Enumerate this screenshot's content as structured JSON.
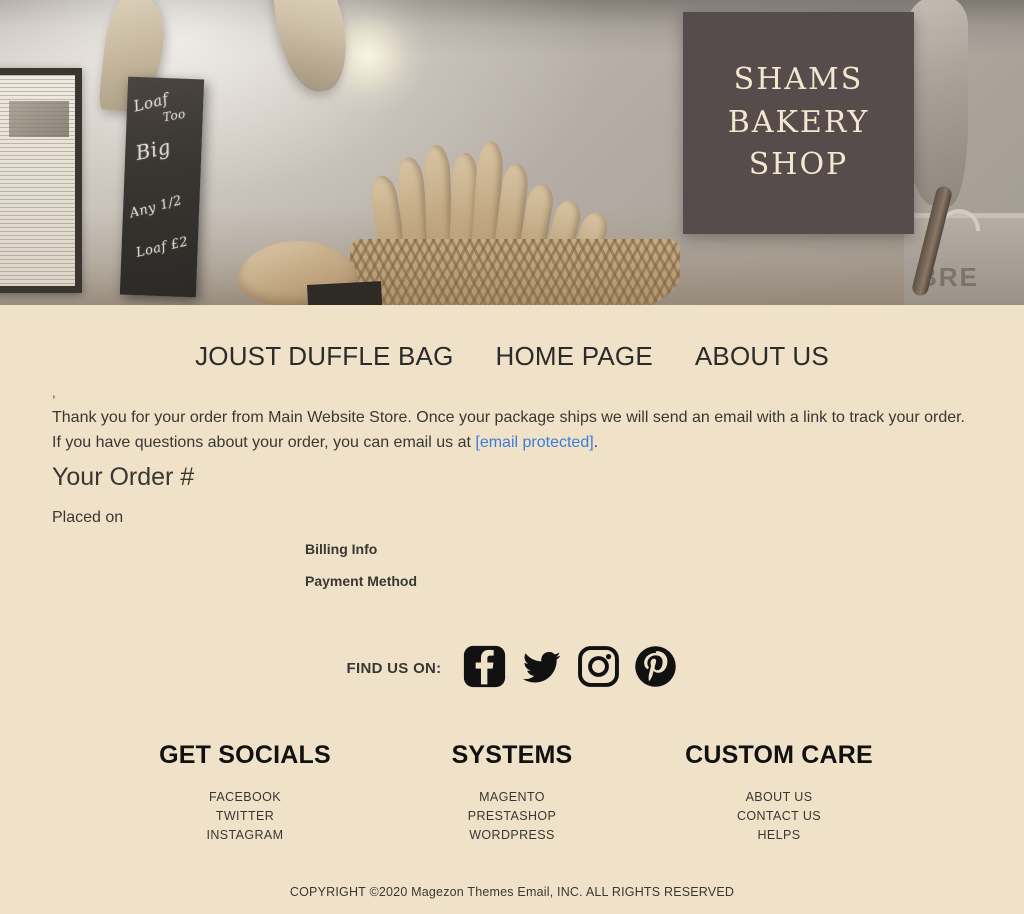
{
  "hero": {
    "sign_lines": [
      "SHAMS",
      "BAKERY",
      "SHOP"
    ],
    "sign_bg_color": "#564c4c",
    "sign_text_color": "#f3e8cf",
    "chalkboard": {
      "line1": "Loaf",
      "line2": "Too",
      "line3": "Big",
      "line4": "Any 1/2",
      "line5": "Loaf £2"
    },
    "crate_label": "BRE"
  },
  "nav": {
    "items": [
      {
        "label": "JOUST DUFFLE BAG"
      },
      {
        "label": "HOME PAGE"
      },
      {
        "label": "ABOUT US"
      }
    ]
  },
  "order": {
    "greeting": ",",
    "paragraph_part1": "Thank you for your order from Main Website Store. Once your package ships we will send an email with a link to track your order. If you have questions about your order, you can email us at ",
    "email_link": "[email protected]",
    "paragraph_part2": ".",
    "order_heading": "Your Order #",
    "placed_on": "Placed on",
    "billing_info_title": "Billing Info",
    "payment_method_title": "Payment Method",
    "link_color": "#3b7dd8"
  },
  "social": {
    "label": "FIND US ON:",
    "icons": [
      {
        "name": "facebook-icon"
      },
      {
        "name": "twitter-icon"
      },
      {
        "name": "instagram-icon"
      },
      {
        "name": "pinterest-icon"
      }
    ]
  },
  "footer": {
    "columns": [
      {
        "title": "GET SOCIALS",
        "links": [
          "FACEBOOK",
          "TWITTER",
          "INSTAGRAM"
        ]
      },
      {
        "title": "SYSTEMS",
        "links": [
          "MAGENTO",
          "PRESTASHOP",
          "WORDPRESS"
        ]
      },
      {
        "title": "CUSTOM CARE",
        "links": [
          "ABOUT US",
          "CONTACT US",
          "HELPS"
        ]
      }
    ],
    "copyright": "COPYRIGHT ©2020 Magezon Themes Email, INC. ALL RIGHTS RESERVED"
  },
  "theme": {
    "page_bg": "#f0e2c8",
    "text_color": "#3a3733"
  }
}
